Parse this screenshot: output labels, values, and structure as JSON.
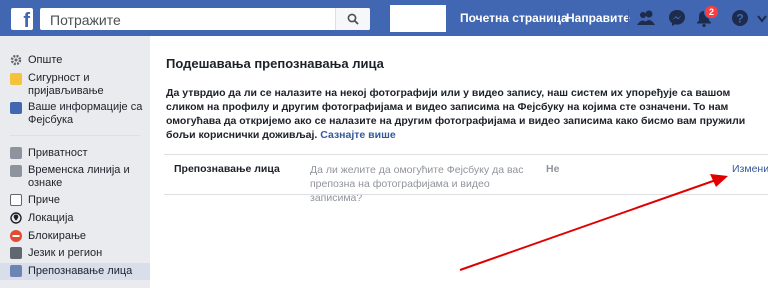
{
  "topbar": {
    "logo": "f",
    "search_placeholder": "Потражите",
    "nav": {
      "home": "Почетна страница",
      "create": "Направите"
    },
    "notifications_count": "2",
    "icons": [
      "friends-icon",
      "messenger-icon",
      "notifications-icon",
      "help-icon",
      "chevron-down-icon"
    ]
  },
  "sidebar": {
    "items": [
      {
        "label": "Опште",
        "icon": "gear-icon"
      },
      {
        "label_1": "Сигурност и",
        "label_2": "пријављивање",
        "icon": "shield-icon"
      },
      {
        "label_1": "Ваше информације са",
        "label_2": "Фејсбука",
        "icon": "facebook-icon"
      },
      {
        "label": "Приватност",
        "icon": "lock-icon"
      },
      {
        "label_1": "Временска линија и",
        "label_2": "ознаке",
        "icon": "timeline-icon"
      },
      {
        "label": "Приче",
        "icon": "book-icon"
      },
      {
        "label": "Локација",
        "icon": "location-icon"
      },
      {
        "label": "Блокирање",
        "icon": "block-icon"
      },
      {
        "label": "Језик и регион",
        "icon": "globe-icon"
      },
      {
        "label": "Препознавање лица",
        "icon": "face-icon"
      }
    ]
  },
  "main": {
    "title": "Подешавања препознавања лица",
    "description": "Да утврдио да ли се налазите на некој фотографији или у видео запису, наш систем их упоређује са вашом сликом на профилу и другим фотографијама и видео записима на Фејсбуку на којима сте означени. То нам омогућава да откријемо ако се налазите на другим фотографијама и видео записима како бисмо вам пружили бољи кориснички доживљај.",
    "learn_more": "Сазнајте више",
    "setting": {
      "label": "Препознавање лица",
      "question": "Да ли желите да омогућите Фејсбуку да вас препозна на фотографијама и видео записима?",
      "value": "Не",
      "edit": "Измени"
    }
  },
  "colors": {
    "topbar": "#4267b2",
    "link": "#365899",
    "arrow": "#e00000",
    "active_item": "#d8dfea"
  }
}
